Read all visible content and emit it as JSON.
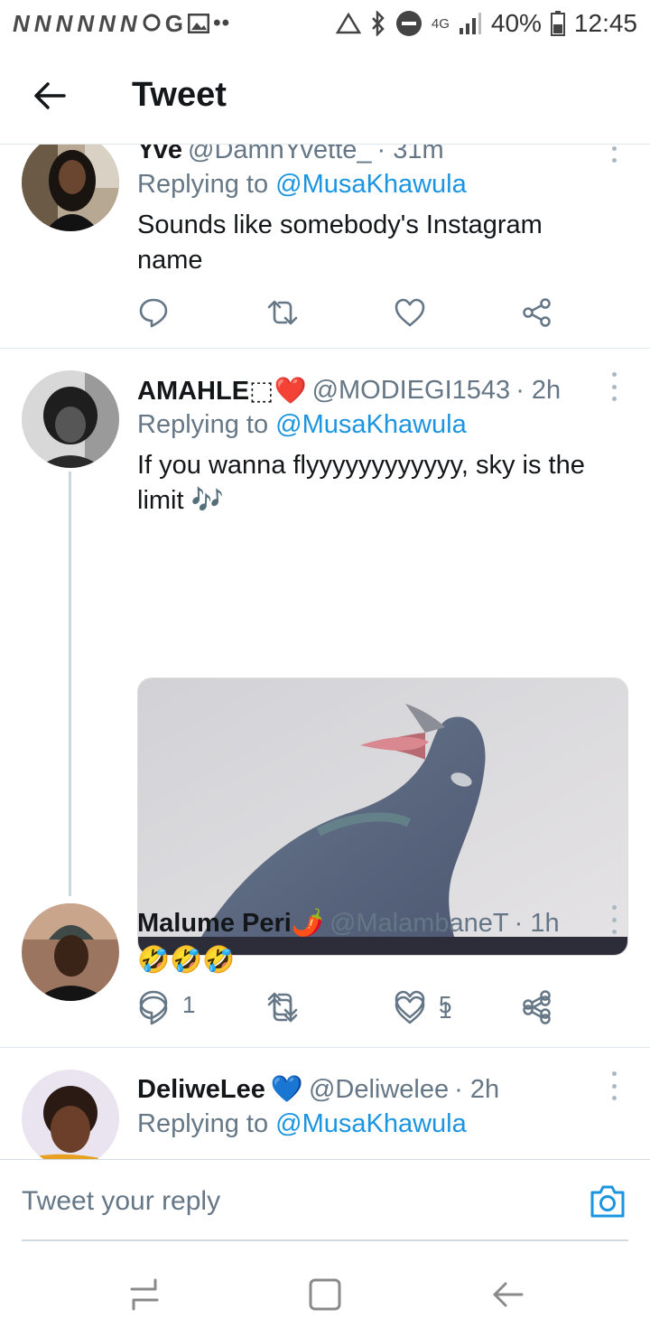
{
  "status_bar": {
    "left_glyphs": [
      "N",
      "N",
      "N",
      "N",
      "N",
      "N"
    ],
    "right_glyphs": [
      "bluetooth-icon",
      "dnd-icon"
    ],
    "network": "4G",
    "battery": "40%",
    "time": "12:45"
  },
  "header": {
    "title": "Tweet"
  },
  "tweets": [
    {
      "name": "Yve",
      "handle": "@DamnYvette_",
      "time": "· 31m",
      "replying_label": "Replying to",
      "replying_to": "@MusaKhawula",
      "text": "Sounds like somebody's  Instagram name",
      "reply_count": "",
      "like_count": ""
    },
    {
      "name": "AMAHLE⬚❤️",
      "handle": "@MODIEGI1543",
      "time": "· 2h",
      "replying_label": "Replying to",
      "replying_to": "@MusaKhawula",
      "text": "If you wanna flyyyyyyyyyyyy, sky is the limit 🎶",
      "reply_count": "1",
      "like_count": "5"
    },
    {
      "name": "Malume Peri🌶️",
      "handle": "@MalambaneT",
      "time": "· 1h",
      "text": "🤣🤣🤣",
      "reply_count": "",
      "like_count": "1"
    },
    {
      "name": "DeliweLee",
      "name_badge": "💙",
      "handle": "@Deliwelee",
      "time": "· 2h",
      "replying_label": "Replying to",
      "replying_to": "@MusaKhawula"
    }
  ],
  "reply_bar": {
    "placeholder": "Tweet your reply"
  },
  "colors": {
    "accent": "#1b95e0",
    "secondary_text": "#657786",
    "divider": "#e1e8ed"
  }
}
